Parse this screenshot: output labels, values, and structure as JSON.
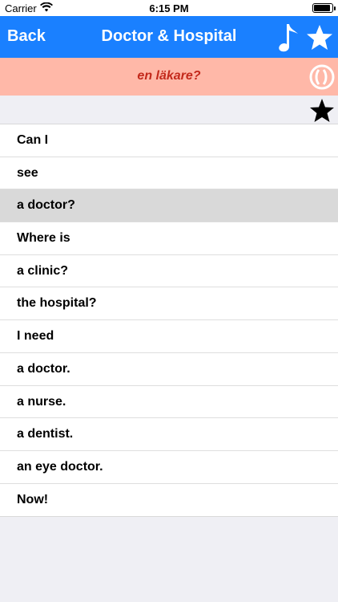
{
  "status": {
    "carrier": "Carrier",
    "time": "6:15 PM"
  },
  "navbar": {
    "back_label": "Back",
    "title": "Doctor & Hospital",
    "music_icon": "music-note-icon",
    "star_icon": "star-icon"
  },
  "translation": {
    "text": "en läkare?",
    "speak_icon": "speak-icon"
  },
  "favorite": {
    "icon": "star-icon"
  },
  "phrases": [
    {
      "label": "Can I"
    },
    {
      "label": "see"
    },
    {
      "label": "a doctor?"
    },
    {
      "label": "Where is"
    },
    {
      "label": "a clinic?"
    },
    {
      "label": "the hospital?"
    },
    {
      "label": "I need"
    },
    {
      "label": "a doctor."
    },
    {
      "label": "a nurse."
    },
    {
      "label": "a dentist."
    },
    {
      "label": "an eye doctor."
    },
    {
      "label": "Now!"
    }
  ],
  "selected_index": 2,
  "colors": {
    "navbar": "#1a80ff",
    "translation_bg": "#ffb8a8",
    "translation_text": "#c3291b",
    "selected_row": "#d9d9d9"
  }
}
